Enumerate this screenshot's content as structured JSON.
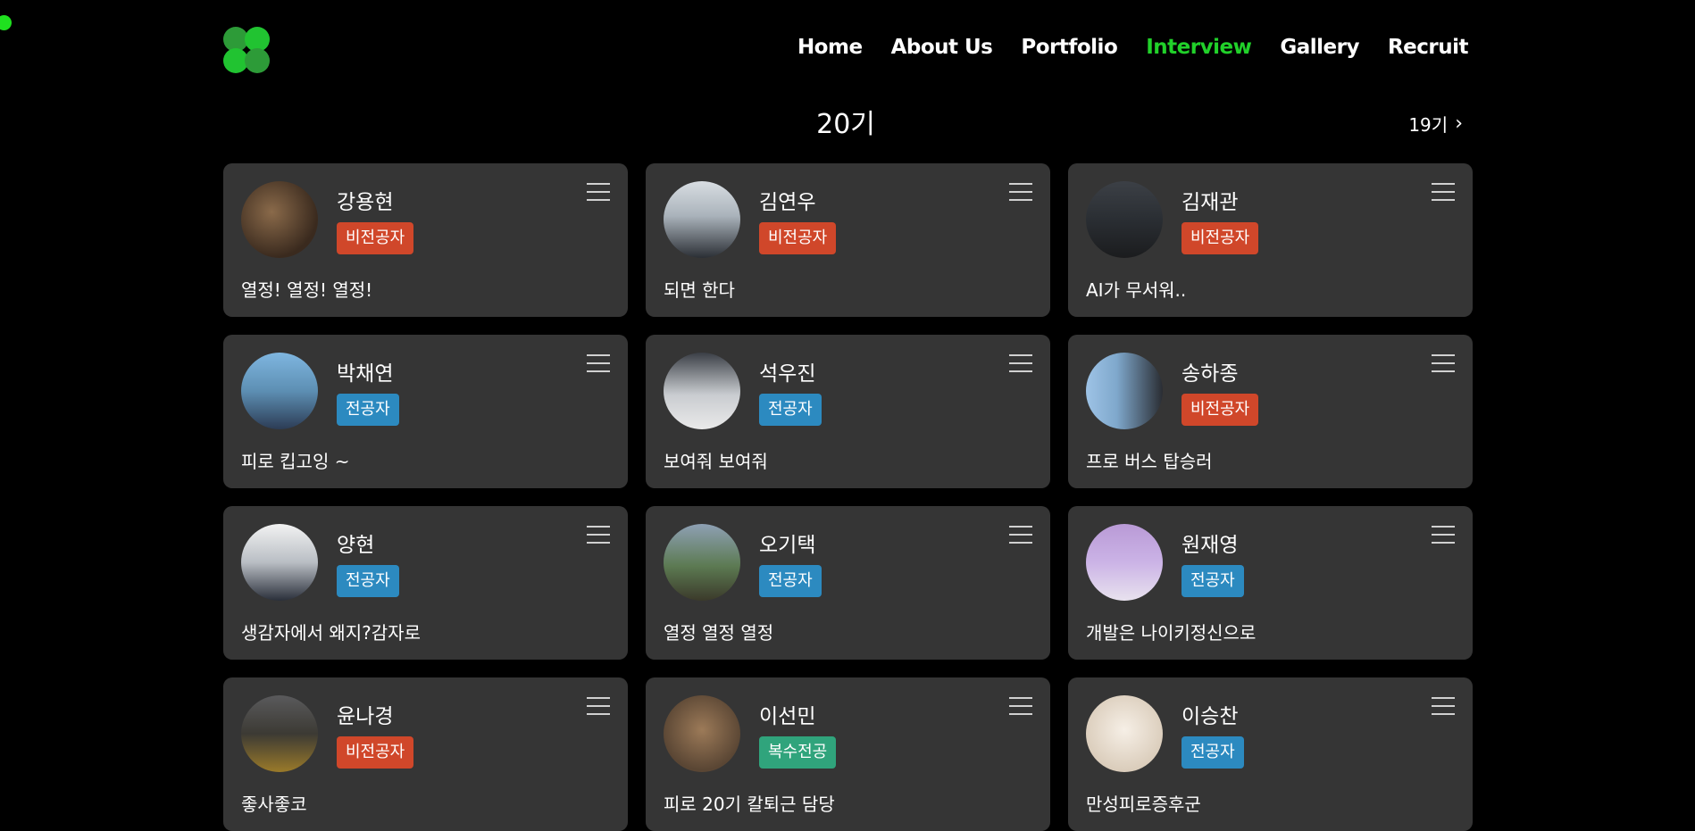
{
  "nav": {
    "items": [
      {
        "label": "Home",
        "active": false
      },
      {
        "label": "About Us",
        "active": false
      },
      {
        "label": "Portfolio",
        "active": false
      },
      {
        "label": "Interview",
        "active": true
      },
      {
        "label": "Gallery",
        "active": false
      },
      {
        "label": "Recruit",
        "active": false
      }
    ],
    "active_color": "#21d12a"
  },
  "generation": {
    "title": "20기",
    "next_label": "19기",
    "next_icon": "chevron-right-icon"
  },
  "badge_colors": {
    "비전공자": "#d0472a",
    "전공자": "#2c8ac0",
    "복수전공": "#30a47c"
  },
  "members": [
    {
      "name": "강용현",
      "badge": "비전공자",
      "motto": "열정! 열정! 열정!"
    },
    {
      "name": "김연우",
      "badge": "비전공자",
      "motto": "되면 한다"
    },
    {
      "name": "김재관",
      "badge": "비전공자",
      "motto": "AI가 무서워.."
    },
    {
      "name": "박채연",
      "badge": "전공자",
      "motto": "피로 킵고잉 ~"
    },
    {
      "name": "석우진",
      "badge": "전공자",
      "motto": "보여줘 보여줘"
    },
    {
      "name": "송하종",
      "badge": "비전공자",
      "motto": "프로 버스 탑승러"
    },
    {
      "name": "양현",
      "badge": "전공자",
      "motto": "생감자에서 왜지?감자로"
    },
    {
      "name": "오기택",
      "badge": "전공자",
      "motto": "열정 열정 열정"
    },
    {
      "name": "원재영",
      "badge": "전공자",
      "motto": "개발은 나이키정신으로"
    },
    {
      "name": "윤나경",
      "badge": "비전공자",
      "motto": "좋사좋코"
    },
    {
      "name": "이선민",
      "badge": "복수전공",
      "motto": "피로 20기 칼퇴근 담당"
    },
    {
      "name": "이승찬",
      "badge": "전공자",
      "motto": "만성피로증후군"
    }
  ]
}
